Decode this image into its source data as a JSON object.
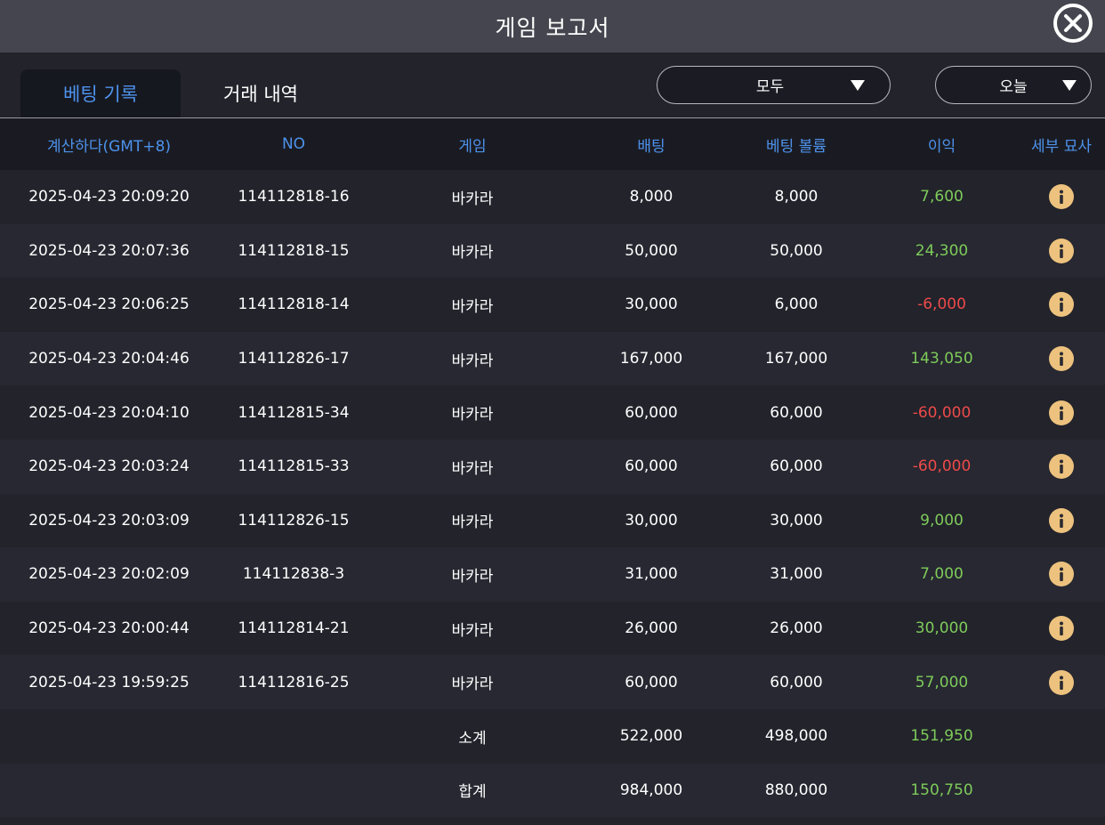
{
  "window": {
    "title": "게임 보고서"
  },
  "tabs": [
    {
      "label": "베팅 기록",
      "active": true
    },
    {
      "label": "거래 내역",
      "active": false
    }
  ],
  "filters": {
    "type": {
      "selected": "모두"
    },
    "period": {
      "selected": "오늘"
    }
  },
  "table": {
    "columns": [
      "계산하다(GMT+8)",
      "NO",
      "게임",
      "배팅",
      "베팅 볼륨",
      "이익",
      "세부 묘사"
    ],
    "rows": [
      {
        "time": "2025-04-23 20:09:20",
        "no": "114112818-16",
        "game": "바카라",
        "bet": "8,000",
        "volume": "8,000",
        "profit": "7,600"
      },
      {
        "time": "2025-04-23 20:07:36",
        "no": "114112818-15",
        "game": "바카라",
        "bet": "50,000",
        "volume": "50,000",
        "profit": "24,300"
      },
      {
        "time": "2025-04-23 20:06:25",
        "no": "114112818-14",
        "game": "바카라",
        "bet": "30,000",
        "volume": "6,000",
        "profit": "-6,000"
      },
      {
        "time": "2025-04-23 20:04:46",
        "no": "114112826-17",
        "game": "바카라",
        "bet": "167,000",
        "volume": "167,000",
        "profit": "143,050"
      },
      {
        "time": "2025-04-23 20:04:10",
        "no": "114112815-34",
        "game": "바카라",
        "bet": "60,000",
        "volume": "60,000",
        "profit": "-60,000"
      },
      {
        "time": "2025-04-23 20:03:24",
        "no": "114112815-33",
        "game": "바카라",
        "bet": "60,000",
        "volume": "60,000",
        "profit": "-60,000"
      },
      {
        "time": "2025-04-23 20:03:09",
        "no": "114112826-15",
        "game": "바카라",
        "bet": "30,000",
        "volume": "30,000",
        "profit": "9,000"
      },
      {
        "time": "2025-04-23 20:02:09",
        "no": "114112838-3",
        "game": "바카라",
        "bet": "31,000",
        "volume": "31,000",
        "profit": "7,000"
      },
      {
        "time": "2025-04-23 20:00:44",
        "no": "114112814-21",
        "game": "바카라",
        "bet": "26,000",
        "volume": "26,000",
        "profit": "30,000"
      },
      {
        "time": "2025-04-23 19:59:25",
        "no": "114112816-25",
        "game": "바카라",
        "bet": "60,000",
        "volume": "60,000",
        "profit": "57,000"
      }
    ],
    "subtotal": {
      "label": "소계",
      "bet": "522,000",
      "volume": "498,000",
      "profit": "151,950"
    },
    "total": {
      "label": "합계",
      "bet": "984,000",
      "volume": "880,000",
      "profit": "150,750"
    }
  },
  "icons": {
    "close": "close-circle-icon",
    "detail": "info-icon",
    "dropdown": "caret-down-icon"
  },
  "colors": {
    "accent": "#4d92ec",
    "positive": "#7ecb5a",
    "negative": "#ee4a4a",
    "info": "#ecc27e"
  }
}
